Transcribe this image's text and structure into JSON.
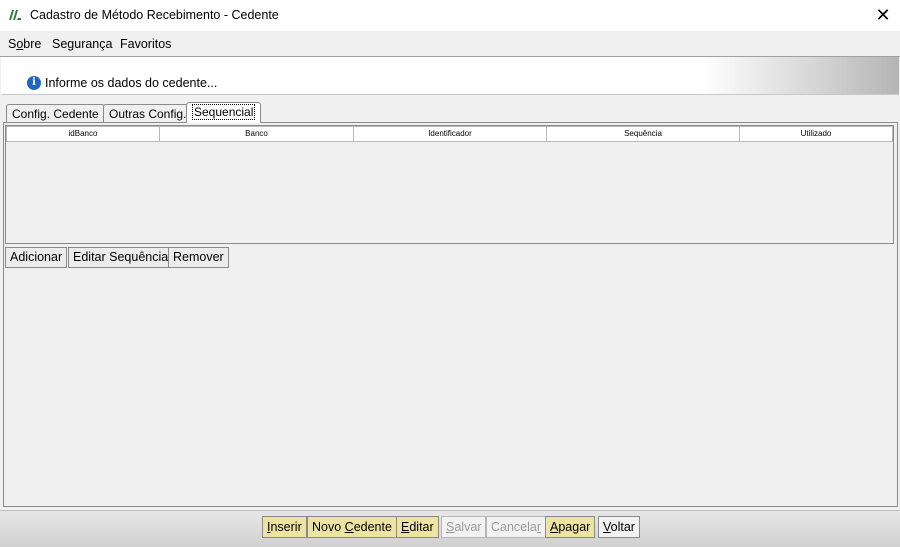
{
  "window": {
    "title": "Cadastro de Método Recebimento - Cedente",
    "close_label": "✕",
    "icon": "app-logo-icon"
  },
  "menu": {
    "items": [
      "Sobre",
      "Segurança",
      "Favoritos"
    ]
  },
  "info": {
    "icon": "info-icon",
    "text": "Informe os dados do cedente..."
  },
  "tabs": [
    {
      "label": "Config. Cedente",
      "active": false
    },
    {
      "label": "Outras Config.",
      "active": false
    },
    {
      "label": "Sequencial",
      "active": true
    }
  ],
  "table": {
    "columns": [
      "idBanco",
      "Banco",
      "Identificador",
      "Sequência",
      "Utilizado"
    ],
    "rows": []
  },
  "table_buttons": [
    "Adicionar",
    "Editar Sequência",
    "Remover"
  ],
  "actions": [
    {
      "label": "Inserir",
      "mnemonic": "I",
      "state": "enabled"
    },
    {
      "label": "Novo Cedente",
      "mnemonic": "C",
      "state": "enabled"
    },
    {
      "label": "Editar",
      "mnemonic": "E",
      "state": "enabled"
    },
    {
      "label": "Salvar",
      "mnemonic": "S",
      "state": "disabled"
    },
    {
      "label": "Cancelar",
      "mnemonic": "r",
      "state": "disabled"
    },
    {
      "label": "Apagar",
      "mnemonic": "A",
      "state": "enabled"
    },
    {
      "label": "Voltar",
      "mnemonic": "V",
      "state": "enabled"
    }
  ],
  "colors": {
    "action_button": "#ede4a4",
    "info_icon": "#1f65c1",
    "logo": "#2f7d3a"
  }
}
